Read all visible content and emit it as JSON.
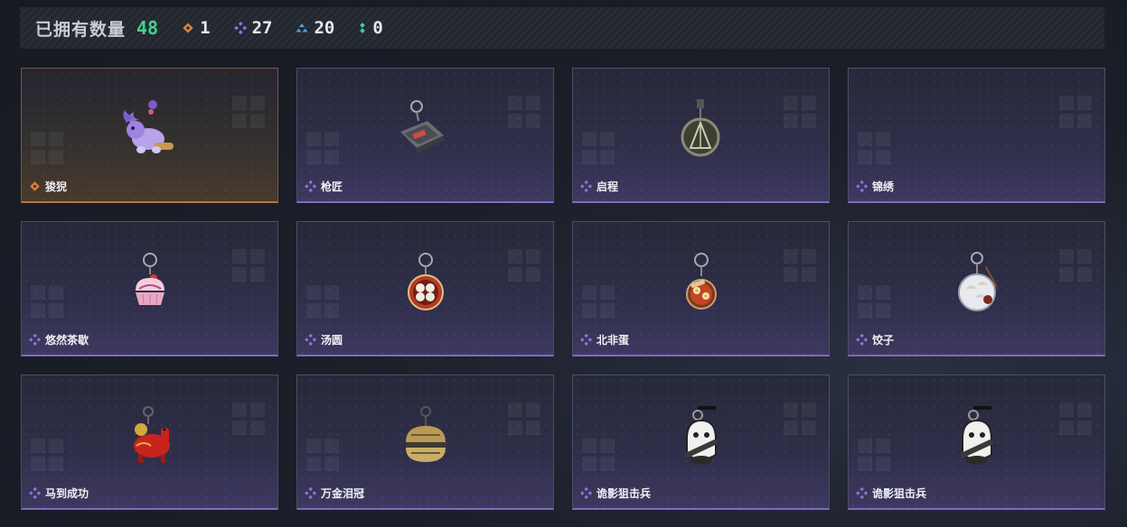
{
  "header": {
    "owned_label": "已拥有数量",
    "owned_count": "48",
    "stats": [
      {
        "icon": "orange-diamond-icon",
        "value": "1",
        "color": "#d9803e"
      },
      {
        "icon": "purple-diamond-icon",
        "value": "27",
        "color": "#8a76d8"
      },
      {
        "icon": "blue-triangle-icon",
        "value": "20",
        "color": "#4f9fe8"
      },
      {
        "icon": "green-dots-icon",
        "value": "0",
        "color": "#3dcfa3"
      }
    ]
  },
  "rarity_colors": {
    "gold": "#c27a3e",
    "purple": "#8a76d8"
  },
  "items": [
    {
      "name": "狻猊",
      "rarity": "gold",
      "icon": "purple-lion-charm-icon"
    },
    {
      "name": "枪匠",
      "rarity": "purple",
      "icon": "gun-case-charm-icon"
    },
    {
      "name": "启程",
      "rarity": "purple",
      "icon": "medal-charm-icon"
    },
    {
      "name": "锦绣",
      "rarity": "purple",
      "icon": "empty-charm-icon"
    },
    {
      "name": "悠然茶歇",
      "rarity": "purple",
      "icon": "cupcake-charm-icon"
    },
    {
      "name": "汤圆",
      "rarity": "purple",
      "icon": "tangyuan-bowl-charm-icon"
    },
    {
      "name": "北非蛋",
      "rarity": "purple",
      "icon": "shakshuka-charm-icon"
    },
    {
      "name": "饺子",
      "rarity": "purple",
      "icon": "dumpling-plate-charm-icon"
    },
    {
      "name": "马到成功",
      "rarity": "purple",
      "icon": "red-horse-charm-icon"
    },
    {
      "name": "万金泪冠",
      "rarity": "purple",
      "icon": "golden-crown-charm-icon"
    },
    {
      "name": "诡影狙击兵",
      "rarity": "purple",
      "icon": "sniper-ghost-charm-icon"
    },
    {
      "name": "诡影狙击兵",
      "rarity": "purple",
      "icon": "sniper-ghost-charm-icon"
    }
  ]
}
